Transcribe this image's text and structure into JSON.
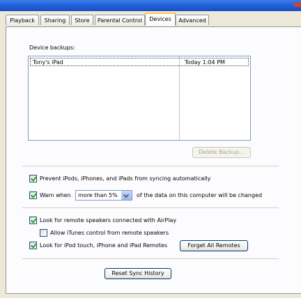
{
  "tabs": [
    {
      "label": "Playback",
      "active": false
    },
    {
      "label": "Sharing",
      "active": false
    },
    {
      "label": "Store",
      "active": false
    },
    {
      "label": "Parental Control",
      "active": false
    },
    {
      "label": "Devices",
      "active": true
    },
    {
      "label": "Advanced",
      "active": false
    }
  ],
  "backups": {
    "label": "Device backups:",
    "rows": [
      {
        "device": "Tony's iPad",
        "date": "Today 1:04 PM"
      }
    ],
    "delete_button": "Delete Backup..."
  },
  "options": {
    "prevent_sync": {
      "label": "Prevent iPods, iPhones, and iPads from syncing automatically",
      "checked": true
    },
    "warn": {
      "label_before": "Warn when",
      "selected": "more than 5%",
      "label_after": "of the data on this computer will be changed",
      "checked": true
    },
    "airplay": {
      "label": "Look for remote speakers connected with AirPlay",
      "checked": true
    },
    "allow_control": {
      "label": "Allow iTunes control from remote speakers",
      "checked": false
    },
    "remotes": {
      "label": "Look for iPod touch, iPhone and iPad Remotes",
      "checked": true
    },
    "forget_button": "Forget All Remotes"
  },
  "reset_button": "Reset Sync History",
  "colors": {
    "titlebar": "#1f5fd6",
    "tab_highlight": "#ffc73c",
    "check": "#21a121"
  }
}
